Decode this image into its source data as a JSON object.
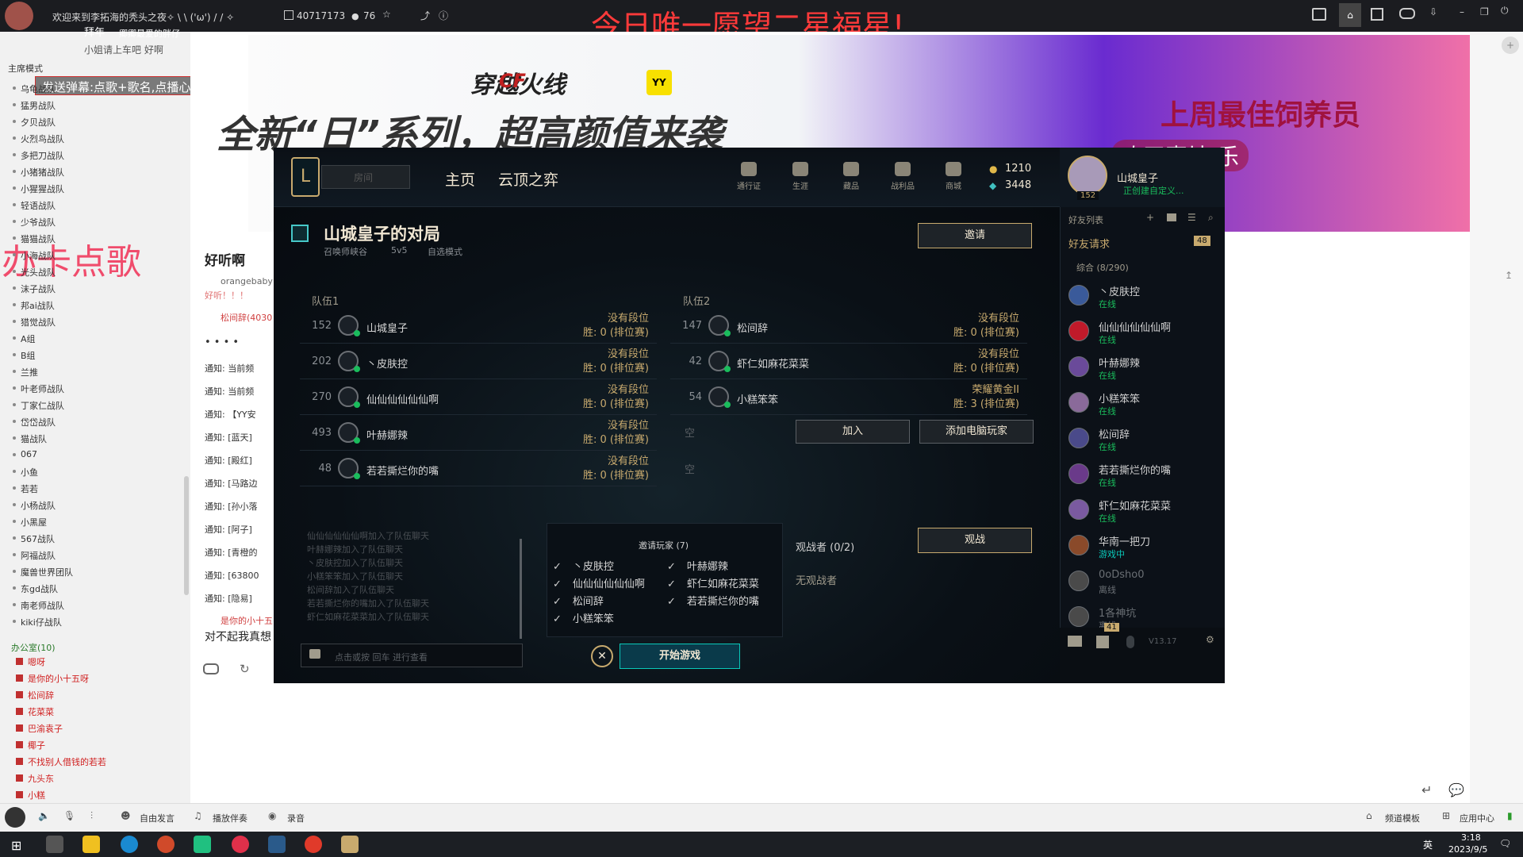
{
  "topbar": {
    "stream_title": "欢迎来到李拓海的秃头之夜✧ \\ \\ ('ω') / / ✧",
    "channel_id": "40717173",
    "viewers": "76",
    "streamer_name": "拜年",
    "streamer_sub": "卿卿最爱的胖仔"
  },
  "overlay": {
    "wish_text": "今日唯一愿望二星福星!",
    "danmu_tip": "发送弹幕:点歌+歌名,点播心仪歌曲",
    "sing_text": "办卡点歌",
    "subtitle_marquee": "小姐请上车吧 好啊",
    "banner_top": "穿越火线",
    "banner_cf": "CF",
    "banner_yy": "YY",
    "banner_slogan": "全新“日”系列，超高颜值来袭",
    "best_feeder": "上周最佳饲养员",
    "happy_text": "欢天喜地 乐"
  },
  "left": {
    "mode": "主席模式",
    "channels": [
      "乌龟战队",
      "猛男战队",
      "夕贝战队",
      "火烈鸟战队",
      "多把刀战队",
      "小猪猪战队",
      "小猩猩战队",
      "轻语战队",
      "少爷战队",
      "猫猫战队",
      "小海战队",
      "光头战队",
      "沫子战队",
      "邦ai战队",
      "猎觉战队",
      "A组",
      "B组",
      "兰推",
      "叶老师战队",
      "丁家仁战队",
      "岱岱战队",
      "猫战队",
      "067",
      "小鱼",
      "若若",
      "小杨战队",
      "小黑屋",
      "567战队",
      "阿福战队",
      "魔兽世界团队",
      "东gd战队",
      "南老师战队",
      "kiki仔战队"
    ],
    "office": "办公室",
    "office_count": "(10)",
    "users": [
      "嗯呀",
      "是你的小十五呀",
      "松间辞",
      "花菜菜",
      "巴渝袁子",
      "椰子",
      "不找别人借钱的若若",
      "九头东",
      "小糕"
    ]
  },
  "chat": {
    "title": "好听啊",
    "user1": "orangebaby",
    "msg1": "好听！！！",
    "user2": "松间辞(4030",
    "dots": "• • • •",
    "notices": [
      "通知: 当前频",
      "通知: 当前频",
      "通知: 【YY安",
      "通知: [蓝天]",
      "通知: [殿红]",
      "通知: [马路边",
      "通知: [孙小落",
      "通知: [阿子]",
      "通知: [青橙的",
      "通知: [63800",
      "通知: [隐易]"
    ],
    "last_user": "是你的小十五",
    "last_msg": "对不起我真想"
  },
  "client": {
    "search_placeholder": "房间",
    "nav_home": "主页",
    "nav_tft": "云顶之弈",
    "icons": [
      "通行证",
      "生涯",
      "藏品",
      "战利品",
      "商城"
    ],
    "rp": "1210",
    "be": "3448",
    "profile_name": "山城皇子",
    "profile_level": "152",
    "profile_status": "正创建自定义...",
    "lobby_title": "山城皇子的对局",
    "lobby_map": "召唤师峡谷",
    "lobby_size": "5v5",
    "lobby_mode": "自选模式",
    "invite_btn": "邀请",
    "team1_label": "队伍1",
    "team2_label": "队伍2",
    "team1": [
      {
        "level": "152",
        "name": "山城皇子",
        "rank": "没有段位",
        "record": "胜:  0  (排位赛)"
      },
      {
        "level": "202",
        "name": "丶皮肤控",
        "rank": "没有段位",
        "record": "胜:  0  (排位赛)"
      },
      {
        "level": "270",
        "name": "仙仙仙仙仙仙啊",
        "rank": "没有段位",
        "record": "胜:  0  (排位赛)"
      },
      {
        "level": "493",
        "name": "叶赫娜辣",
        "rank": "没有段位",
        "record": "胜:  0  (排位赛)"
      },
      {
        "level": "48",
        "name": "若若撕烂你的嘴",
        "rank": "没有段位",
        "record": "胜:  0  (排位赛)"
      }
    ],
    "team2": [
      {
        "level": "147",
        "name": "松间辞",
        "rank": "没有段位",
        "record": "胜:  0  (排位赛)"
      },
      {
        "level": "42",
        "name": "虾仁如麻花菜菜",
        "rank": "没有段位",
        "record": "胜:  0  (排位赛)"
      },
      {
        "level": "54",
        "name": "小糕笨笨",
        "rank": "荣耀黄金II",
        "record": "胜:  3  (排位赛)"
      }
    ],
    "empty": "空",
    "join_btn": "加入",
    "add_bot_btn": "添加电脑玩家",
    "chat_log": [
      "仙仙仙仙仙仙啊加入了队伍聊天",
      "叶赫娜辣加入了队伍聊天",
      "丶皮肤控加入了队伍聊天",
      "小糕笨笨加入了队伍聊天",
      "松间辞加入了队伍聊天",
      "若若撕烂你的嘴加入了队伍聊天",
      "虾仁如麻花菜菜加入了队伍聊天"
    ],
    "chat_placeholder": "点击或按 回车 进行查看",
    "invited_title": "邀请玩家 (7)",
    "invited_col1": [
      "丶皮肤控",
      "仙仙仙仙仙仙啊",
      "松间辞",
      "小糕笨笨"
    ],
    "invited_col2": [
      "叶赫娜辣",
      "虾仁如麻花菜菜",
      "若若撕烂你的嘴"
    ],
    "spectators_title": "观战者 (0/2)",
    "spectate_btn": "观战",
    "no_spectators": "无观战者",
    "start_btn": "开始游戏",
    "friends_title": "好友列表",
    "friend_requests": "好友请求",
    "friend_requests_count": "48",
    "group": "综合 (8/290)",
    "friends": [
      {
        "name": "丶皮肤控",
        "status": "在线"
      },
      {
        "name": "仙仙仙仙仙仙啊",
        "status": "在线"
      },
      {
        "name": "叶赫娜辣",
        "status": "在线"
      },
      {
        "name": "小糕笨笨",
        "status": "在线"
      },
      {
        "name": "松间辞",
        "status": "在线"
      },
      {
        "name": "若若撕烂你的嘴",
        "status": "在线"
      },
      {
        "name": "虾仁如麻花菜菜",
        "status": "在线"
      },
      {
        "name": "华南一把刀",
        "status": "游戏中"
      },
      {
        "name": "0oDsho0",
        "status": "离线"
      },
      {
        "name": "1各神坑",
        "status": "离线"
      }
    ],
    "notif_count": "41",
    "version": "V13.17"
  },
  "bottom": {
    "free_speak": "自由发言",
    "play_accompany": "播放伴奏",
    "record": "录音",
    "channel_template": "频道模板",
    "app_center": "应用中心"
  },
  "taskbar": {
    "ime": "英",
    "time": "3:18",
    "date": "2023/9/5"
  },
  "colors": {
    "gold": "#c8aa6e",
    "online": "#1abc5c",
    "wish": "#ff3a3a"
  }
}
